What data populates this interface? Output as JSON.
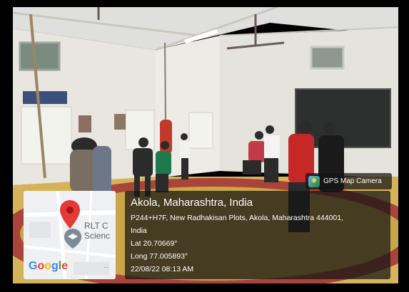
{
  "gps_badge": {
    "label": "GPS Map Camera",
    "icon": "gps-map-camera-app-icon"
  },
  "map": {
    "place_line1": "RLT C",
    "place_line2": "Scienc",
    "logo_text": "Google",
    "logo_colors": [
      "#4285F4",
      "#EA4335",
      "#FBBC05",
      "#4285F4",
      "#34A853",
      "#EA4335"
    ],
    "pin_color": "#E53935",
    "more_icon": "..."
  },
  "location": {
    "title": "Akola, Maharashtra, India",
    "address_line1": "P244+H7F, New Radhakisan Plots, Akola, Maharashtra 444001,",
    "address_line2": "India",
    "lat": "Lat 20.70669°",
    "long": "Long 77.005893°",
    "datetime": "22/08/22 08:13 AM"
  }
}
